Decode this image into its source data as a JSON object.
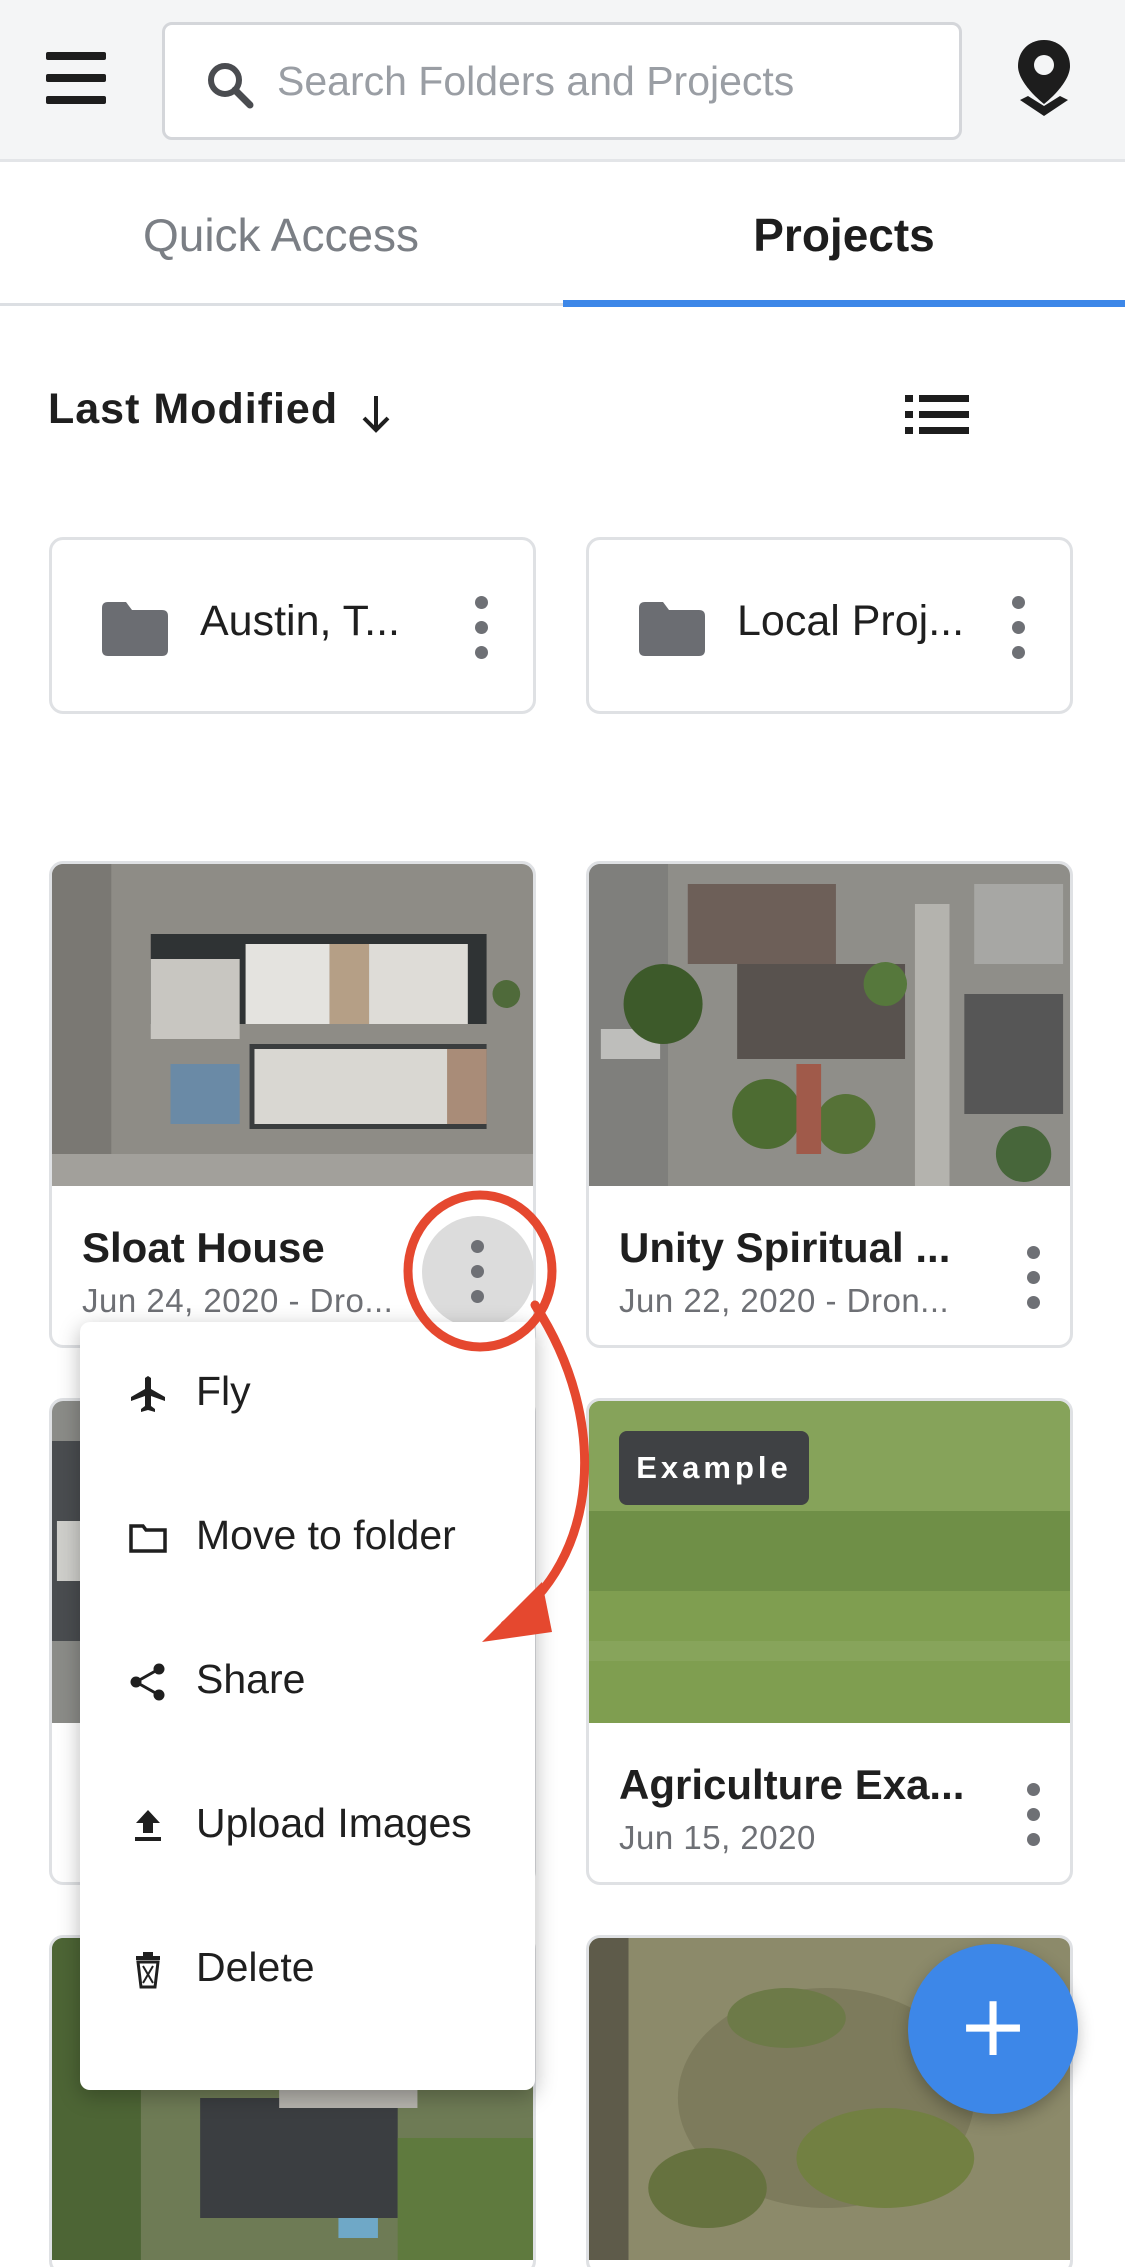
{
  "header": {
    "search_placeholder": "Search Folders and Projects",
    "menu_icon": "hamburger-menu-icon",
    "location_icon": "map-pin-icon"
  },
  "tabs": [
    {
      "label": "Quick Access",
      "active": false
    },
    {
      "label": "Projects",
      "active": true
    }
  ],
  "sort": {
    "label": "Last Modified",
    "direction_icon": "arrow-down-icon",
    "view_toggle_icon": "list-view-icon"
  },
  "folders": [
    {
      "name": "Austin, T..."
    },
    {
      "name": "Local Proj..."
    }
  ],
  "projects": [
    {
      "title": "Sloat House",
      "subtitle": "Jun 24, 2020 - Dro..."
    },
    {
      "title": "Unity Spiritual ...",
      "subtitle": "Jun 22, 2020 - Dron..."
    },
    {
      "title": "Agriculture Exa...",
      "subtitle": "Jun 15, 2020",
      "badge": "Example"
    }
  ],
  "context_menu": {
    "items": [
      {
        "label": "Fly",
        "icon": "airplane-icon"
      },
      {
        "label": "Move to folder",
        "icon": "folder-outline-icon"
      },
      {
        "label": "Share",
        "icon": "share-icon"
      },
      {
        "label": "Upload Images",
        "icon": "upload-icon"
      },
      {
        "label": "Delete",
        "icon": "trash-icon"
      }
    ]
  },
  "fab": {
    "label": "+",
    "icon": "plus-icon"
  },
  "colors": {
    "accent": "#3d87e8",
    "annotation": "#e5482f",
    "badge_bg": "#3f4144"
  }
}
